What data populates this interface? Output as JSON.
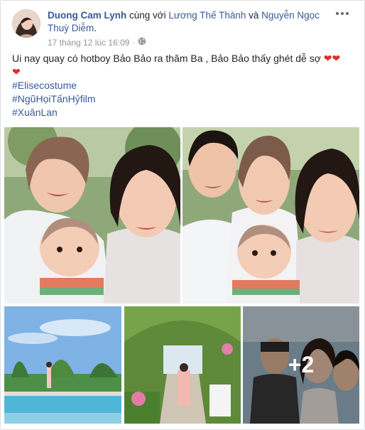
{
  "post": {
    "author": "Duong Cam Lynh",
    "with_text": " cùng với ",
    "tagged_1": "Lương Thế Thành",
    "and_text": " và ",
    "tagged_2": "Nguyễn Ngọc Thuỳ Diễm",
    "end_text": ".",
    "timestamp": "17 tháng 12 lúc 16:09",
    "separator": "·",
    "privacy_icon": "globe-icon",
    "caption_text": "Ui nay quay có hotboy Bảo Bảo ra thăm Ba , Bảo Bảo thấy ghét dễ sợ ",
    "heart": "❤",
    "hashtags": [
      "#Elisecostume",
      "#NgũHọiTấnHỷfilm",
      "#XuânLan"
    ],
    "more_photos_label": "+2"
  },
  "icons": {
    "more": "more-options-icon",
    "globe": "globe-icon",
    "heart": "heart-emoji-icon"
  },
  "colors": {
    "link": "#385898",
    "meta": "#90949c",
    "heart": "#e02b2b"
  }
}
